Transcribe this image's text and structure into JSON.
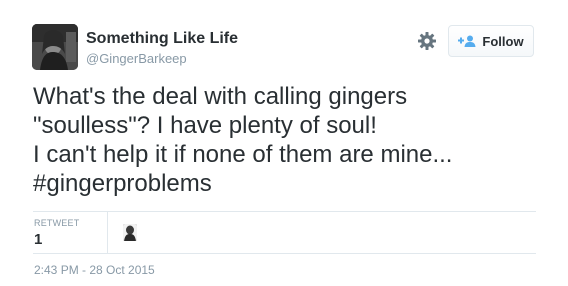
{
  "author": {
    "name": "Something Like Life",
    "handle": "@GingerBarkeep"
  },
  "header": {
    "settings_icon": "gear-icon",
    "follow_label": "Follow",
    "follow_icon": "add-user-icon",
    "accent_color": "#55acee"
  },
  "tweet": {
    "lines": [
      "What's the deal with calling gingers",
      "\"soulless\"? I have plenty of soul!",
      "I can't help it if none of them are mine...",
      "#gingerproblems"
    ]
  },
  "stats": {
    "retweet_label": "RETWEET",
    "retweet_count": "1"
  },
  "timestamp": "2:43 PM - 28 Oct 2015"
}
